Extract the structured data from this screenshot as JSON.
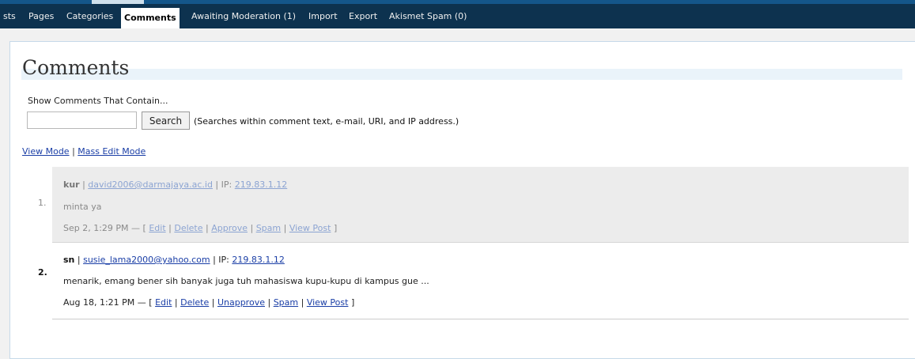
{
  "nav": {
    "items": [
      {
        "label": "sts",
        "active": false
      },
      {
        "label": "Pages",
        "active": false
      },
      {
        "label": "Categories",
        "active": false
      },
      {
        "label": "Comments",
        "active": true
      },
      {
        "label": "Awaiting Moderation (1)",
        "active": false
      },
      {
        "label": "Import",
        "active": false
      },
      {
        "label": "Export",
        "active": false
      },
      {
        "label": "Akismet Spam (0)",
        "active": false
      }
    ]
  },
  "page": {
    "title": "Comments"
  },
  "search": {
    "label": "Show Comments That Contain...",
    "value": "",
    "button": "Search",
    "hint": "(Searches within comment text, e-mail, URI, and IP address.)"
  },
  "modes": {
    "view": "View Mode",
    "sep": " | ",
    "mass_edit": "Mass Edit Mode"
  },
  "comments": [
    {
      "number": "1.",
      "author": "kur",
      "email": "david2006@darmajaya.ac.id",
      "ip_label": "IP:",
      "ip": "219.83.1.12",
      "text": "minta ya",
      "date": "Sep 2, 1:29 PM — [",
      "actions": [
        "Edit",
        "Delete",
        "Approve",
        "Spam",
        "View Post"
      ],
      "close": "]",
      "status": "unapproved"
    },
    {
      "number": "2.",
      "author": "sn",
      "email": "susie_lama2000@yahoo.com",
      "ip_label": "IP:",
      "ip": "219.83.1.12",
      "text": "menarik, emang bener sih banyak juga tuh mahasiswa kupu-kupu di kampus gue ...",
      "date": "Aug 18, 1:21 PM — [",
      "actions": [
        "Edit",
        "Delete",
        "Unapprove",
        "Spam",
        "View Post"
      ],
      "close": "]",
      "status": "approved"
    }
  ],
  "sep": " | "
}
